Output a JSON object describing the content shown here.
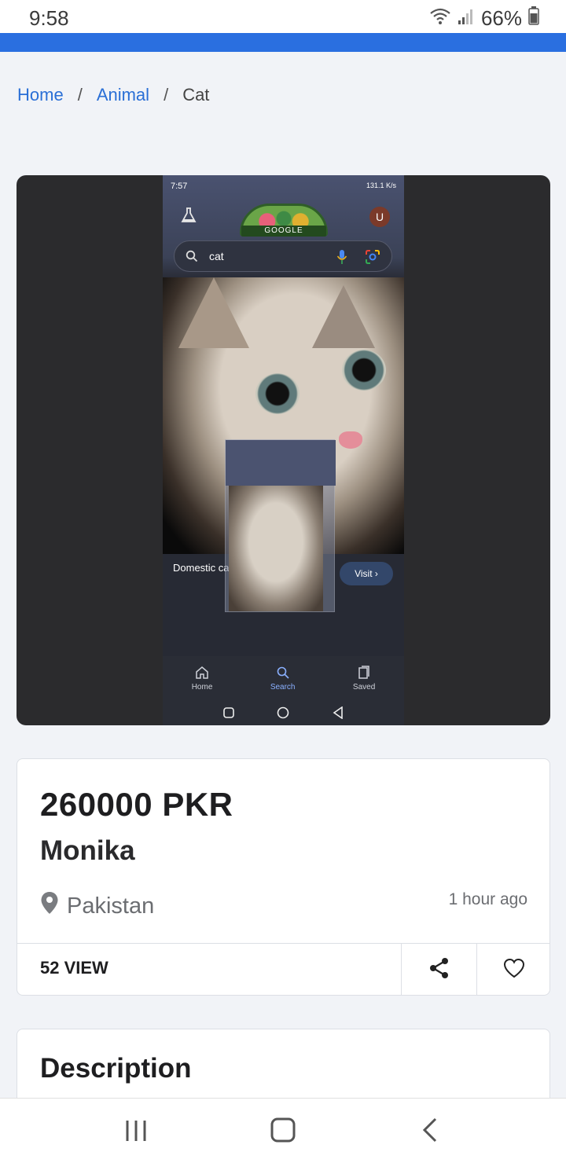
{
  "status_bar": {
    "time": "9:58",
    "battery": "66%"
  },
  "breadcrumb": {
    "items": [
      "Home",
      "Animal"
    ],
    "separator": "/",
    "current": "Cat"
  },
  "embedded_screenshot": {
    "time": "7:57",
    "speed": "131.1 K/s",
    "doodle_text": "GOOGLE",
    "avatar_letter": "U",
    "search_query": "cat",
    "result_title": "Domestic cat",
    "visit_label": "Visit",
    "nav": [
      "Home",
      "Search",
      "Saved"
    ]
  },
  "listing": {
    "price": "260000 PKR",
    "seller": "Monika",
    "location": "Pakistan",
    "posted": "1 hour ago",
    "views": "52 VIEW"
  },
  "description": {
    "title": "Description"
  },
  "colors": {
    "accent": "#2a6fe0",
    "link": "#2a6fd6",
    "background": "#f1f3f7"
  },
  "icons": [
    "wifi-icon",
    "signal-icon",
    "battery-icon",
    "location-pin-icon",
    "share-icon",
    "heart-icon",
    "recents-icon",
    "home-circle-icon",
    "back-icon"
  ]
}
